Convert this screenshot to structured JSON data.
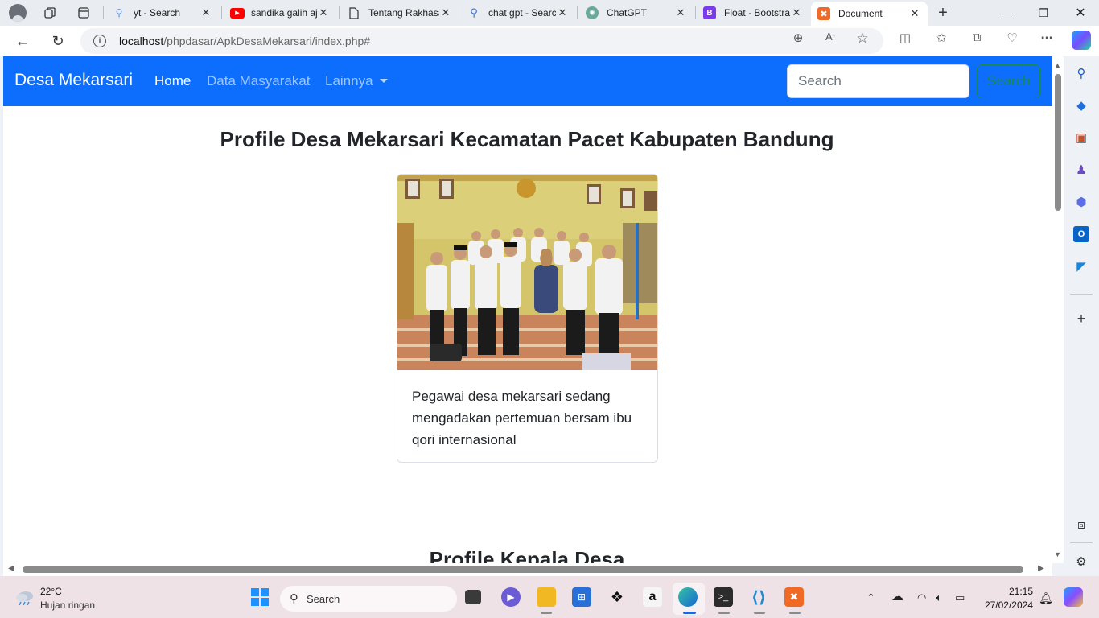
{
  "browser": {
    "tabs": [
      {
        "label": "yt - Search",
        "icon": "search-icon"
      },
      {
        "label": "sandika galih ajax",
        "icon": "youtube-icon"
      },
      {
        "label": "Tentang Rakhasa",
        "icon": "page-icon"
      },
      {
        "label": "chat gpt - Search",
        "icon": "search-icon"
      },
      {
        "label": "ChatGPT",
        "icon": "chatgpt-icon"
      },
      {
        "label": "Float · Bootstrap",
        "icon": "bootstrap-icon"
      },
      {
        "label": "Document",
        "icon": "xampp-icon",
        "active": true
      }
    ],
    "url_host": "localhost",
    "url_path": "/phpdasar/ApkDesaMekarsari/index.php#"
  },
  "site": {
    "brand": "Desa Mekarsari",
    "nav": {
      "home": "Home",
      "data": "Data Masyarakat",
      "more": "Lainnya"
    },
    "search_placeholder": "Search",
    "search_button": "Search",
    "page_title": "Profile Desa Mekarsari Kecamatan Pacet Kabupaten Bandung",
    "card_text": "Pegawai desa mekarsari sedang mengadakan pertemuan bersam ibu qori internasional",
    "section2_title": "Profile Kepala Desa",
    "colors": {
      "navbar": "#0d6efd",
      "search_button": "#198754"
    }
  },
  "taskbar": {
    "temp": "22°C",
    "weather": "Hujan ringan",
    "search_label": "Search",
    "time": "21:15",
    "date": "27/02/2024"
  }
}
